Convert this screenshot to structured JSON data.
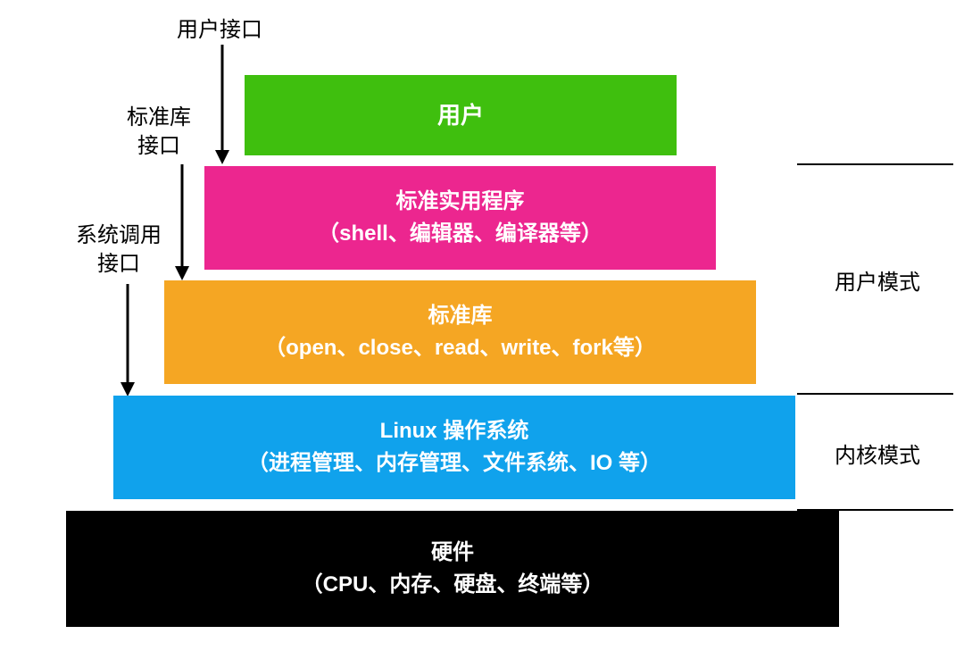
{
  "annotations": {
    "user_interface": "用户接口",
    "stdlib_interface": "标准库\n接口",
    "syscall_interface": "系统调用\n接口"
  },
  "layers": {
    "user": {
      "title": "用户"
    },
    "utilities": {
      "title": "标准实用程序",
      "sub": "（shell、编辑器、编译器等）"
    },
    "stdlib": {
      "title": "标准库",
      "sub": "（open、close、read、write、fork等）"
    },
    "os": {
      "title": "Linux 操作系统",
      "sub": "（进程管理、内存管理、文件系统、IO 等）"
    },
    "hardware": {
      "title": "硬件",
      "sub": "（CPU、内存、硬盘、终端等）"
    }
  },
  "modes": {
    "user_mode": "用户模式",
    "kernel_mode": "内核模式"
  },
  "colors": {
    "user": "#3fbf0e",
    "utilities": "#ec268f",
    "stdlib": "#f5a623",
    "os": "#10a2ec",
    "hardware": "#000000"
  }
}
